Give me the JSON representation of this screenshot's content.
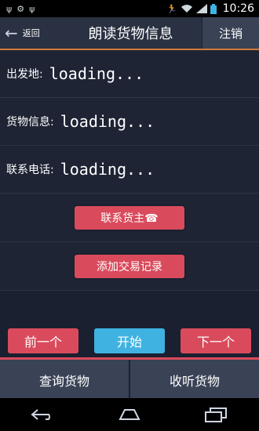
{
  "status_bar": {
    "time": "10:26",
    "icons": [
      "usb-icon",
      "android-debug-icon",
      "usb-icon",
      "running-icon",
      "wifi-icon",
      "cell-signal-icon",
      "battery-icon"
    ]
  },
  "header": {
    "back_label": "返回",
    "title": "朗读货物信息",
    "logout_label": "注销"
  },
  "info": {
    "departure_label": "出发地:",
    "departure_value": "loading...",
    "cargo_label": "货物信息:",
    "cargo_value": "loading...",
    "phone_label": "联系电话:",
    "phone_value": "loading..."
  },
  "actions": {
    "contact_owner": "联系货主☎",
    "add_record": "添加交易记录"
  },
  "nav": {
    "prev": "前一个",
    "start": "开始",
    "next": "下一个"
  },
  "bottom_tabs": {
    "query": "查询货物",
    "listen": "收听货物"
  },
  "colors": {
    "accent_red": "#d94b5c",
    "accent_blue": "#3fb2e2",
    "header_underline": "#d07b3a",
    "background": "#1a2030"
  }
}
